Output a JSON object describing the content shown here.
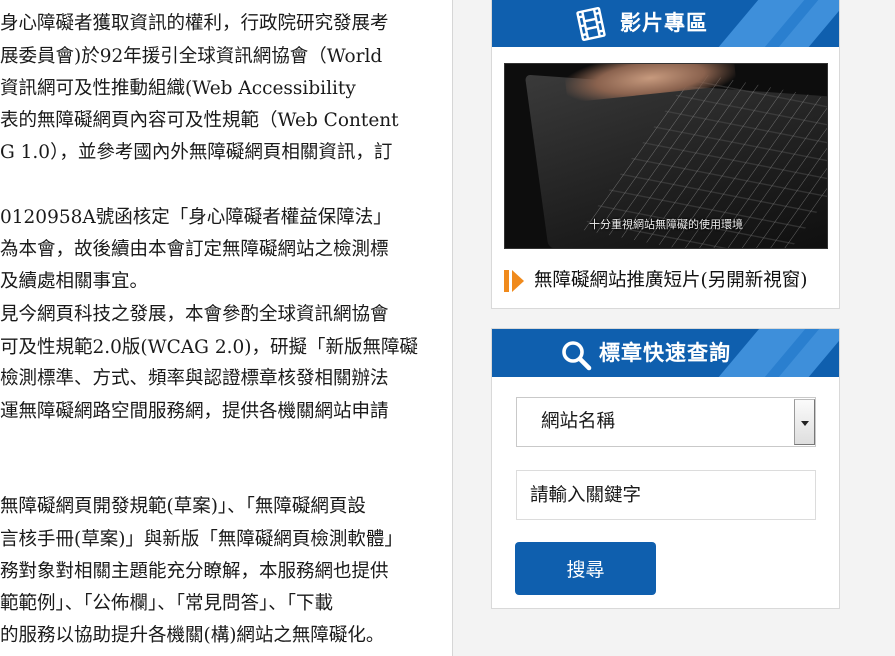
{
  "article": {
    "lines": [
      "身心障礙者獲取資訊的權利，行政院研究發展考",
      "展委員會)於92年援引全球資訊網協會（World",
      "資訊網可及性推動組織(Web Accessibility",
      "表的無障礙網頁內容可及性規範（Web Content",
      "G 1.0），並參考國內外無障礙網頁相關資訊，訂",
      "0120958A號函核定「身心障礙者權益保障法」",
      "為本會，故後續由本會訂定無障礙網站之檢測標",
      "及續處相關事宜。",
      "見今網頁科技之發展，本會參酌全球資訊網協會",
      "可及性規範2.0版(WCAG 2.0)，研擬「新版無障礙",
      "檢測標準、方式、頻率與認證標章核發相關辦法",
      "運無障礙網路空間服務網，提供各機關網站申請",
      "無障礙網頁開發規範(草案)」、「無障礙網頁設",
      "言核手冊(草案)」與新版「無障礙網頁檢測軟體」",
      "務對象對相關主題能充分瞭解，本服務網也提供",
      "範範例」、「公佈欄」、「常見問答」、「下載",
      "的服務以協助提升各機關(構)網站之無障礙化。"
    ]
  },
  "video_panel": {
    "title": "影片專區",
    "header_icon": "film-icon",
    "thumbnail_caption": "十分重視網站無障礙的使用環境",
    "link_icon": "play-arrow-icon",
    "link_label": "無障礙網站推廣短片(另開新視窗)"
  },
  "search_panel": {
    "title": "標章快速查詢",
    "header_icon": "search-icon",
    "select_value": "網站名稱",
    "keyword_placeholder": "請輸入關鍵字",
    "submit_label": "搜尋"
  },
  "colors": {
    "header_blue": "#0f5fae",
    "header_stripe": "#3e8fda",
    "button_blue": "#0f5fae",
    "accent_orange": "#f08a1c",
    "sidebar_bg": "#f3f3f3"
  }
}
